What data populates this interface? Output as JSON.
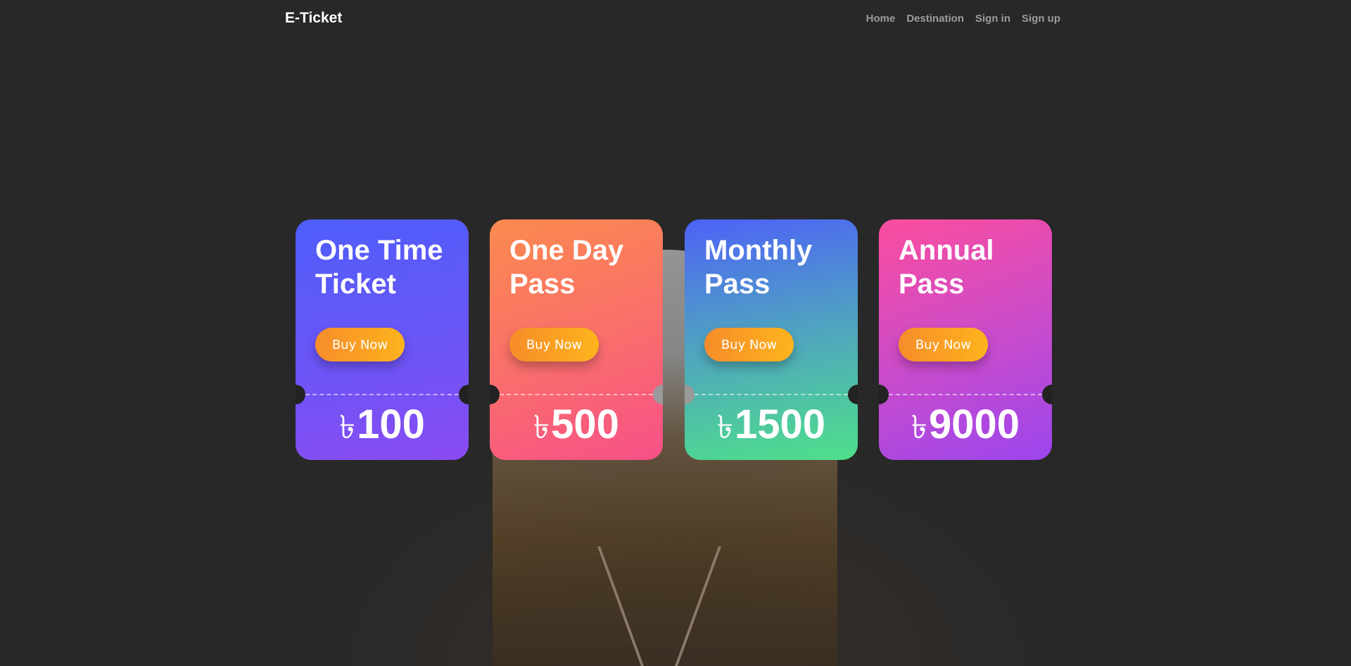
{
  "nav": {
    "brand": "E-Ticket",
    "links": [
      "Home",
      "Destination",
      "Sign in",
      "Sign up"
    ]
  },
  "cards": [
    {
      "title": "One Time Ticket",
      "button": "Buy Now",
      "currency": "৳",
      "price": "100"
    },
    {
      "title": "One Day Pass",
      "button": "Buy Now",
      "currency": "৳",
      "price": "500"
    },
    {
      "title": "Monthly Pass",
      "button": "Buy Now",
      "currency": "৳",
      "price": "1500"
    },
    {
      "title": "Annual Pass",
      "button": "Buy Now",
      "currency": "৳",
      "price": "9000"
    }
  ],
  "colors": {
    "background": "#282828",
    "button_from": "#f78c2a",
    "button_to": "#fdb41d"
  }
}
